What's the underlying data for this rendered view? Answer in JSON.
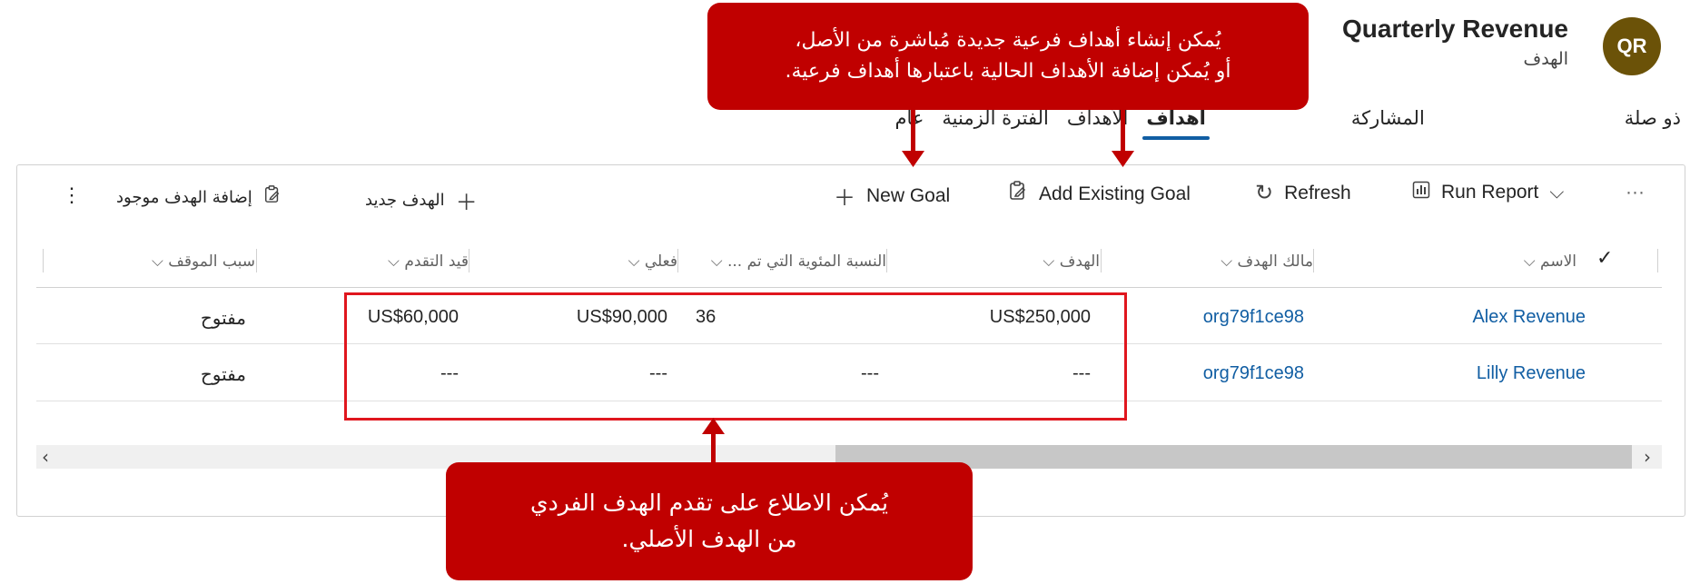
{
  "record": {
    "avatar_initials": "QR",
    "title": "Quarterly Revenue",
    "subtitle": "الهدف"
  },
  "tabs": [
    {
      "label": "عام",
      "active": false
    },
    {
      "label": "الفترة الزمنية",
      "active": false
    },
    {
      "label": "الأهداف",
      "active": false
    },
    {
      "label": "أهداف",
      "active": true
    },
    {
      "label": "المشاركة",
      "active": false
    },
    {
      "label": "ذو صلة",
      "active": false
    }
  ],
  "toolbar_en": {
    "new_goal": "New Goal",
    "add_existing_goal": "Add Existing Goal",
    "refresh": "Refresh",
    "run_report": "Run Report",
    "more": "···"
  },
  "toolbar_ar": {
    "new_goal": "الهدف جديد",
    "add_existing_goal": "إضافة الهدف موجود",
    "more": "⋮"
  },
  "columns": [
    {
      "label": "الاسم"
    },
    {
      "label": "مالك الهدف"
    },
    {
      "label": "الهدف"
    },
    {
      "label": "النسبة المئوية التي تم ..."
    },
    {
      "label": "فعلي"
    },
    {
      "label": "قيد التقدم"
    },
    {
      "label": "سبب الموقف"
    }
  ],
  "rows": [
    {
      "name": "Alex Revenue",
      "owner": "org79f1ce98",
      "target": "US$250,000",
      "percent": "36",
      "actual": "US$90,000",
      "in_progress": "US$60,000",
      "status_reason": "مفتوح"
    },
    {
      "name": "Lilly Revenue",
      "owner": "org79f1ce98",
      "target": "---",
      "percent": "---",
      "actual": "---",
      "in_progress": "---",
      "status_reason": "مفتوح"
    }
  ],
  "callouts": {
    "top_line1": "يُمكن إنشاء أهداف فرعية جديدة مُباشرة من الأصل،",
    "top_line2": "أو يُمكن إضافة الأهداف الحالية باعتبارها أهداف فرعية.",
    "bottom_line1": "يُمكن الاطلاع على تقدم الهدف الفردي",
    "bottom_line2": "من الهدف الأصلي."
  },
  "colors": {
    "callout": "#c00000",
    "highlight_border": "#e0161e",
    "link": "#115ea3",
    "avatar": "#6b5208"
  }
}
